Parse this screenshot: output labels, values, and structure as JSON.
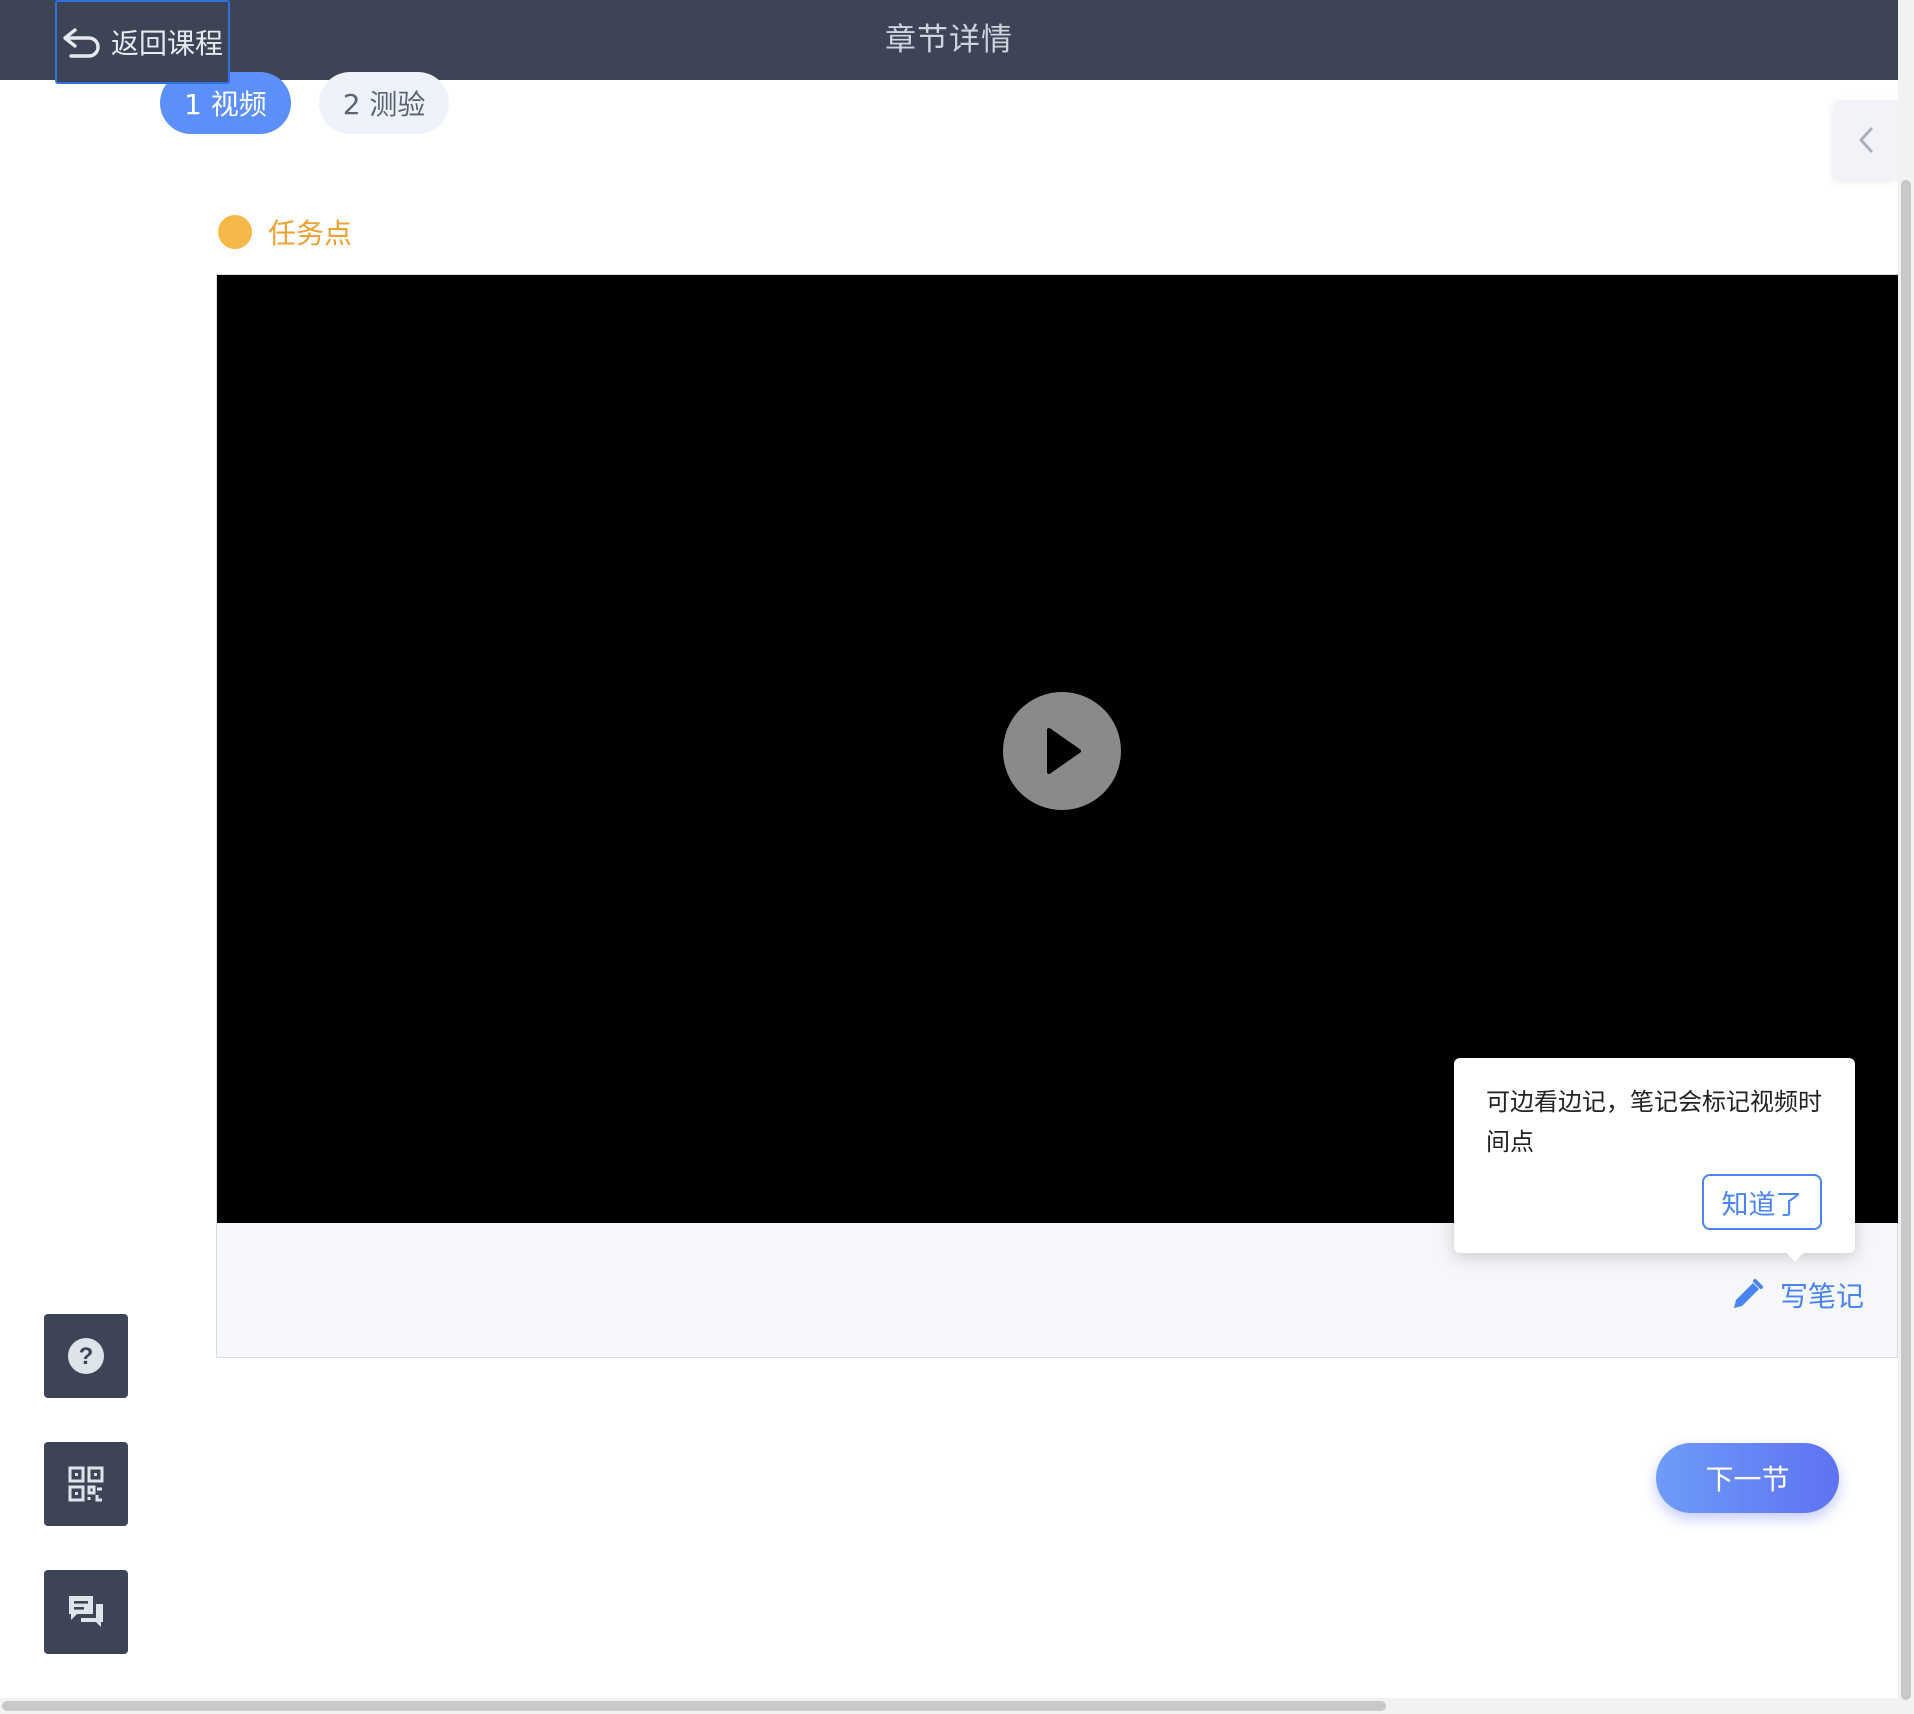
{
  "header": {
    "back_label": "返回课程",
    "title": "章节详情"
  },
  "tabs": [
    {
      "label": "1 视频",
      "active": true
    },
    {
      "label": "2 测验",
      "active": false
    }
  ],
  "task": {
    "label": "任务点"
  },
  "video": {
    "note_label": "写笔记"
  },
  "tooltip": {
    "text": "可边看边记，笔记会标记视频时间点",
    "confirm_label": "知道了"
  },
  "next": {
    "label": "下一节"
  },
  "tools": [
    "help-icon",
    "qrcode-icon",
    "chat-icon"
  ],
  "colors": {
    "header_bg": "#3c4456",
    "accent": "#5b8ff9",
    "task": "#f0a030"
  }
}
